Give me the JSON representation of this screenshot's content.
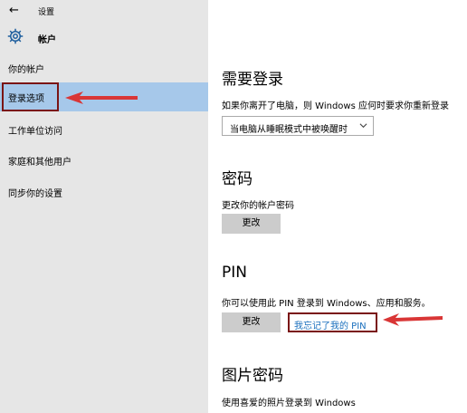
{
  "window": {
    "back_glyph": "←",
    "title": "设置"
  },
  "header": {
    "title": "帐户"
  },
  "sidebar": {
    "items": [
      {
        "label": "你的帐户"
      },
      {
        "label": "登录选项",
        "selected": true
      },
      {
        "label": "工作单位访问"
      },
      {
        "label": "家庭和其他用户"
      },
      {
        "label": "同步你的设置"
      }
    ]
  },
  "main": {
    "require_signin": {
      "heading": "需要登录",
      "description": "如果你离开了电脑，则 Windows 应何时要求你重新登录",
      "dropdown_value": "当电脑从睡眠模式中被唤醒时"
    },
    "password": {
      "heading": "密码",
      "description": "更改你的帐户密码",
      "button": "更改"
    },
    "pin": {
      "heading": "PIN",
      "description": "你可以使用此 PIN 登录到 Windows、应用和服务。",
      "button": "更改",
      "forgot_link": "我忘记了我的 PIN"
    },
    "picture_password": {
      "heading": "图片密码",
      "description": "使用喜爱的照片登录到 Windows"
    }
  },
  "colors": {
    "sidebar_bg": "#e6e6e6",
    "selected_bg": "#a6c8ea",
    "annotation_red": "#d93636",
    "annotation_box": "#7a1414",
    "link": "#1a6fbd",
    "button_bg": "#cccccc"
  }
}
